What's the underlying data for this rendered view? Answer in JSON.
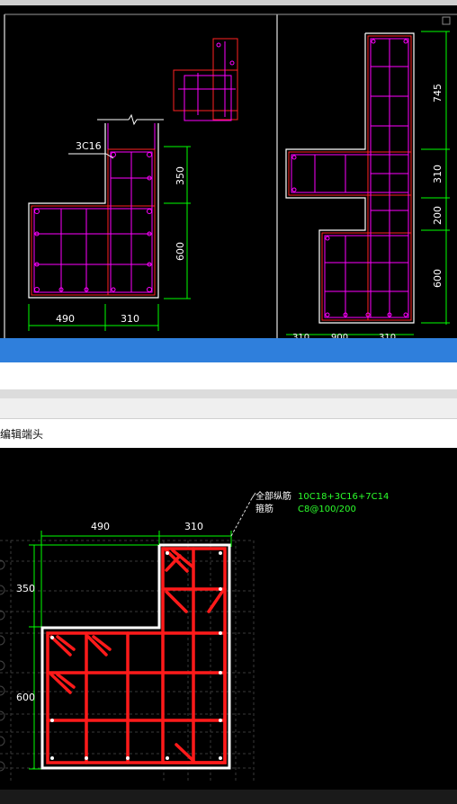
{
  "top_view": {
    "left_callout": "3C16",
    "left_dims": {
      "h1": "350",
      "h2": "600",
      "w1": "490",
      "w2": "310"
    },
    "right_dims": {
      "h1": "745",
      "h2": "310",
      "h3": "200",
      "h4": "600"
    },
    "bottom_cut": [
      "310",
      "900",
      "310"
    ]
  },
  "editor": {
    "title": "编辑端头",
    "dims": {
      "w1": "490",
      "w2": "310",
      "h1": "350",
      "h2": "600"
    },
    "legend": {
      "all_bars_label": "全部纵筋",
      "all_bars_value": "10C18+3C16+7C14",
      "stirrup_label": "箍筋",
      "stirrup_value": "C8@100/200"
    }
  },
  "colors": {
    "rebar_magenta": "#ff00ff",
    "rebar_red": "#ff1a1a",
    "dim_green": "#00ff00",
    "outline_white": "#ffffff",
    "legend_green": "#2cff2c"
  }
}
